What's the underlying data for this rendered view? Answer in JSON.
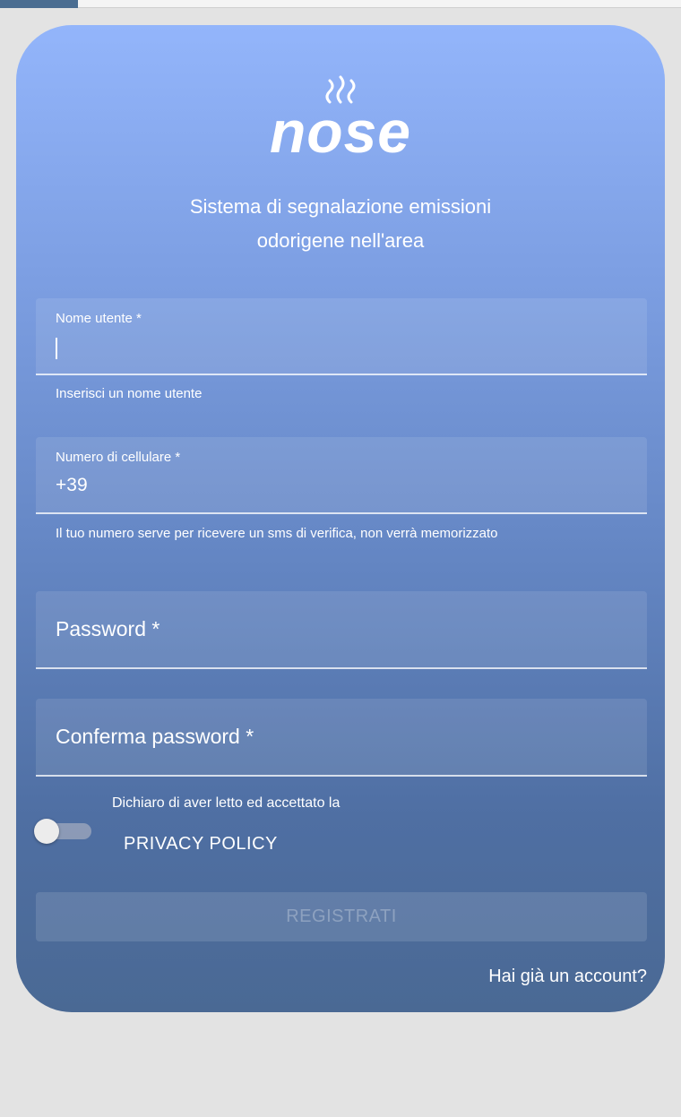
{
  "app": {
    "logo_text": "nose",
    "tagline_line1": "Sistema di segnalazione emissioni",
    "tagline_line2": "odorigene nell'area"
  },
  "form": {
    "username": {
      "label": "Nome utente *",
      "value": "",
      "helper": "Inserisci un nome utente"
    },
    "phone": {
      "label": "Numero di cellulare *",
      "value": "+39",
      "helper": "Il tuo numero serve per ricevere un sms di verifica, non verrà memorizzato"
    },
    "password": {
      "label": "Password *"
    },
    "confirm_password": {
      "label": "Conferma password *"
    },
    "privacy": {
      "text": "Dichiaro di aver letto ed accettato la",
      "link": "PRIVACY POLICY",
      "toggle_on": false
    },
    "register_label": "REGISTRATI",
    "account_link": "Hai già un account?"
  },
  "colors": {
    "card_top": "#93b5fb",
    "card_bottom": "#4a6994",
    "page_background": "#e3e3e3",
    "accent": "#4a6d91"
  }
}
